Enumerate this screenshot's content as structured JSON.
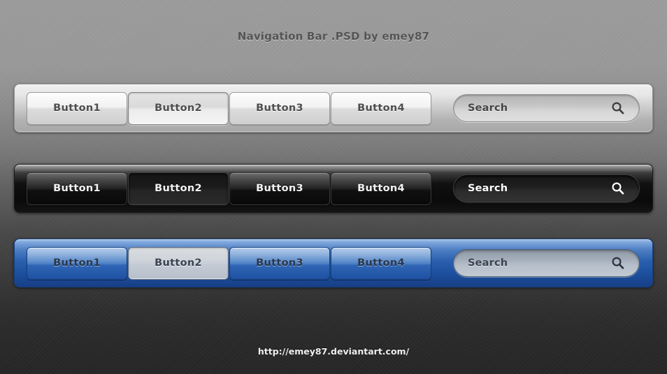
{
  "page": {
    "title": "Navigation Bar .PSD by emey87",
    "footer_url": "http://emey87.deviantart.com/"
  },
  "colors": {
    "background_top": "#9c9c9c",
    "background_bottom": "#262626",
    "light_bar": "#e6e6e6",
    "dark_bar": "#0a0a0a",
    "blue_bar": "#2a60ae",
    "blue_accent": "#1d519f"
  },
  "bars": [
    {
      "name": "light",
      "style_label": "light",
      "buttons": [
        {
          "label": "Button1",
          "active": false
        },
        {
          "label": "Button2",
          "active": true
        },
        {
          "label": "Button3",
          "active": false
        },
        {
          "label": "Button4",
          "active": false
        }
      ],
      "search": {
        "placeholder": "Search",
        "value": "",
        "icon": "magnifier-icon"
      }
    },
    {
      "name": "dark",
      "style_label": "dark",
      "buttons": [
        {
          "label": "Button1",
          "active": false
        },
        {
          "label": "Button2",
          "active": true
        },
        {
          "label": "Button3",
          "active": false
        },
        {
          "label": "Button4",
          "active": false
        }
      ],
      "search": {
        "placeholder": "Search",
        "value": "",
        "icon": "magnifier-icon"
      }
    },
    {
      "name": "blue",
      "style_label": "blue",
      "buttons": [
        {
          "label": "Button1",
          "active": false
        },
        {
          "label": "Button2",
          "active": true
        },
        {
          "label": "Button3",
          "active": false
        },
        {
          "label": "Button4",
          "active": false
        }
      ],
      "search": {
        "placeholder": "Search",
        "value": "",
        "icon": "magnifier-icon"
      }
    }
  ]
}
